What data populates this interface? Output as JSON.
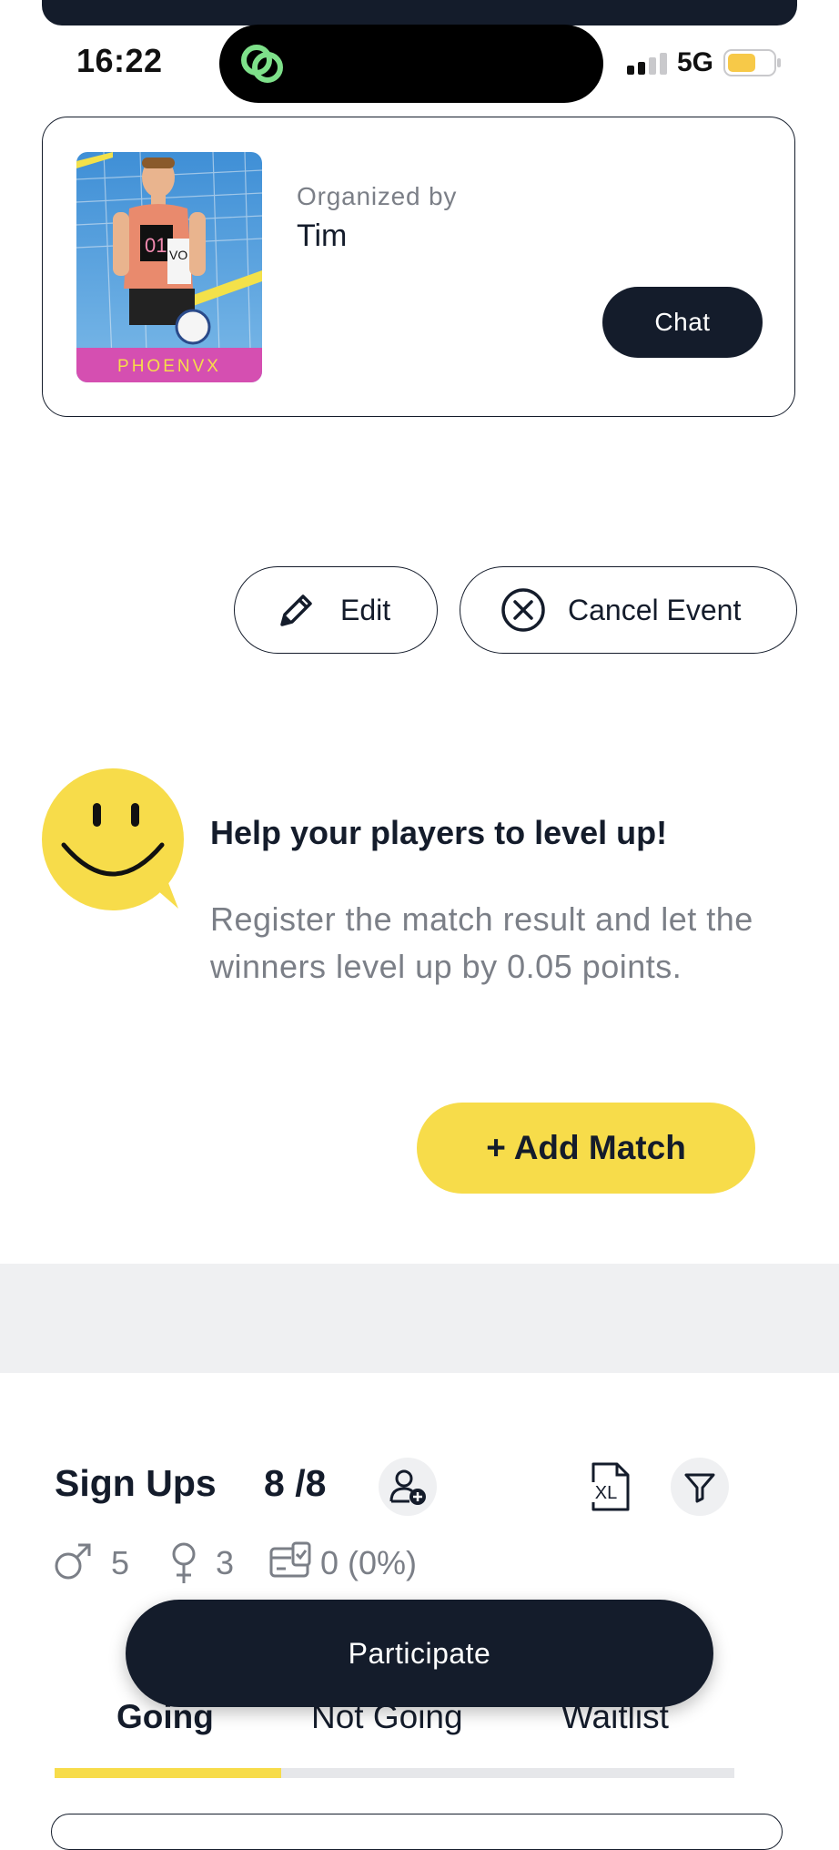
{
  "status_bar": {
    "time": "16:22",
    "network": "5G",
    "signal_bars_active": 2,
    "battery_level": 0.6,
    "battery_color": "#f7c948",
    "island_icon_color": "#7ee08a"
  },
  "organizer": {
    "label": "Organized by",
    "name": "Tim",
    "photo_brand": "PHOENVX",
    "chat_label": "Chat"
  },
  "actions": {
    "edit_label": "Edit",
    "cancel_label": "Cancel Event"
  },
  "level_up": {
    "title": "Help your players to level up!",
    "description": "Register the match result and let the winners level up by 0.05 points.",
    "add_match_label": "+ Add Match"
  },
  "signups": {
    "title": "Sign Ups",
    "count": "8 /8",
    "male_count": "5",
    "female_count": "3",
    "paid": "0 (0%)"
  },
  "participate_label": "Participate",
  "tabs": {
    "going": "Going",
    "not_going": "Not Going",
    "waitlist": "Waitlist",
    "active": "Going"
  },
  "colors": {
    "navy": "#141c2b",
    "accent_yellow": "#f7dc4a",
    "muted_text": "#7b7f87",
    "band_gray": "#eff0f2"
  }
}
